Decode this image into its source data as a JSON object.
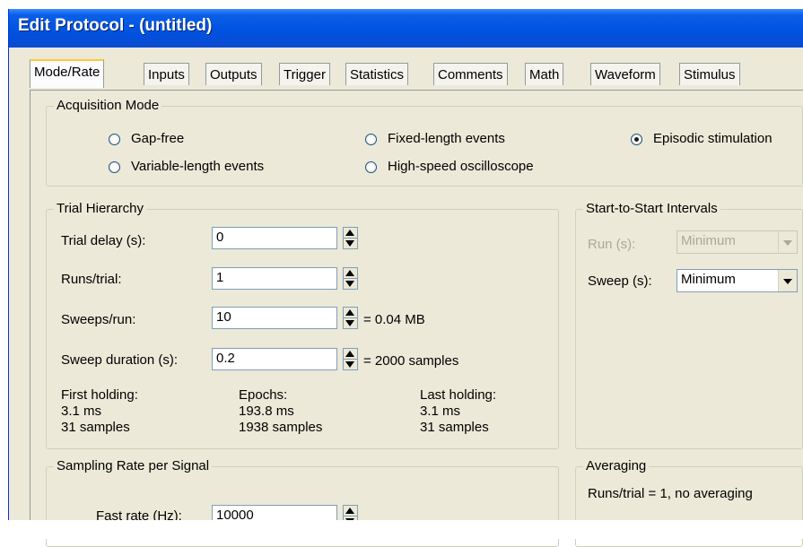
{
  "window": {
    "title": "Edit Protocol - (untitled)"
  },
  "tabs": [
    "Mode/Rate",
    "Inputs",
    "Outputs",
    "Trigger",
    "Statistics",
    "Comments",
    "Math",
    "Waveform",
    "Stimulus"
  ],
  "acquisition_mode": {
    "legend": "Acquisition Mode",
    "options": {
      "gap_free": "Gap-free",
      "variable_length": "Variable-length events",
      "fixed_length": "Fixed-length events",
      "high_speed": "High-speed oscilloscope",
      "episodic": "Episodic stimulation"
    },
    "selected": "Episodic stimulation"
  },
  "trial_hierarchy": {
    "legend": "Trial Hierarchy",
    "trial_delay": {
      "label": "Trial delay (s):",
      "value": "0"
    },
    "runs_per_trial": {
      "label": "Runs/trial:",
      "value": "1"
    },
    "sweeps_per_run": {
      "label": "Sweeps/run:",
      "value": "10",
      "note": "= 0.04 MB"
    },
    "sweep_duration": {
      "label": "Sweep duration (s):",
      "value": "0.2",
      "note": "= 2000 samples"
    },
    "first_holding": {
      "title": "First holding:",
      "ms": "3.1 ms",
      "samples": "31 samples"
    },
    "epochs": {
      "title": "Epochs:",
      "ms": "193.8 ms",
      "samples": "1938 samples"
    },
    "last_holding": {
      "title": "Last holding:",
      "ms": "3.1 ms",
      "samples": "31 samples"
    }
  },
  "start_to_start": {
    "legend": "Start-to-Start Intervals",
    "run": {
      "label": "Run (s):",
      "value": "Minimum"
    },
    "sweep": {
      "label": "Sweep (s):",
      "value": "Minimum"
    }
  },
  "sampling": {
    "legend": "Sampling Rate per Signal",
    "fast_rate": {
      "label": "Fast rate  (Hz):",
      "value": "10000"
    }
  },
  "averaging": {
    "legend": "Averaging",
    "text": "Runs/trial = 1, no averaging"
  }
}
